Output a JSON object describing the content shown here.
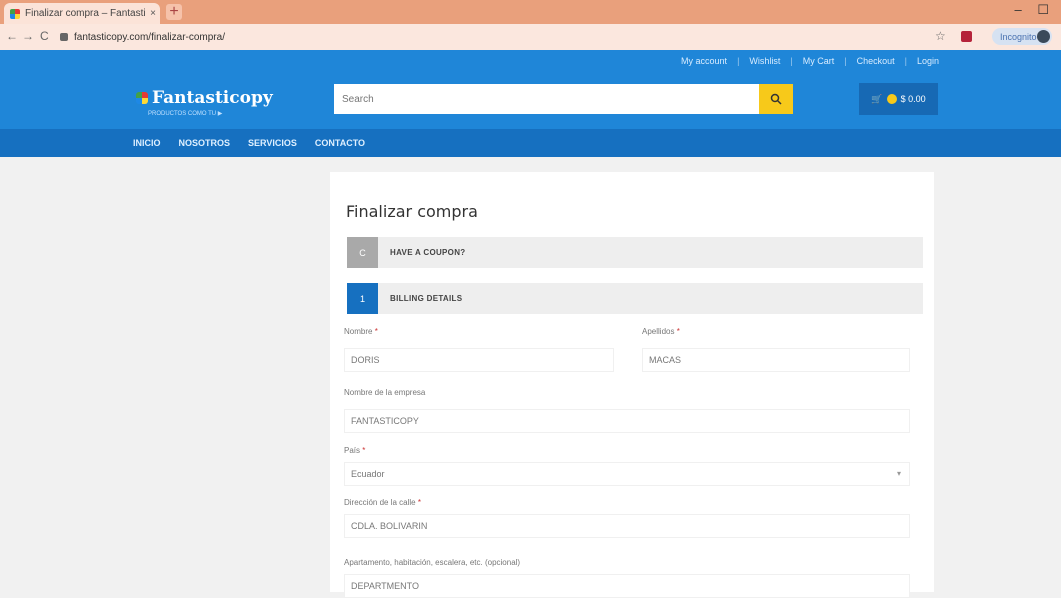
{
  "browser": {
    "tab_title": "Finalizar compra – Fantasticopy",
    "tab_close": "×",
    "new_tab": "+",
    "window_controls": "–  ☐",
    "back": "←",
    "forward": "→",
    "reload": "C",
    "url": "fantasticopy.com/finalizar-compra/",
    "profile_label": "Incognito",
    "star": "☆"
  },
  "header": {
    "top_links": [
      "My account",
      "Wishlist",
      "My Cart",
      "Checkout",
      "Login"
    ],
    "logo_text": "Fantasticopy",
    "tagline": "PRODUCTOS COMO TU ▶",
    "search_placeholder": "Search",
    "cart_label": "$ 0.00",
    "cart_icon": "cart-icon"
  },
  "nav": {
    "items": [
      "INICIO",
      "NOSOTROS",
      "SERVICIOS",
      "CONTACTO"
    ]
  },
  "checkout": {
    "title": "Finalizar compra",
    "coupon": {
      "num": "C",
      "label": "HAVE A COUPON?"
    },
    "billing": {
      "num": "1",
      "label": "BILLING DETAILS"
    },
    "fields": {
      "nombre_label": "Nombre",
      "nombre_value": "DORIS",
      "apellidos_label": "Apellidos",
      "apellidos_value": "MACAS",
      "empresa_label": "Nombre de la empresa",
      "empresa_value": "FANTASTICOPY",
      "pais_label": "País",
      "pais_value": "Ecuador",
      "direccion_label": "Dirección de la calle",
      "direccion_value": "CDLA. BOLIVARIN",
      "apartamento_label": "Apartamento, habitación, escalera, etc. (opcional)",
      "apartamento_value": "DEPARTMENTO"
    },
    "required_mark": "*"
  },
  "colors": {
    "primary": "#1f86d8",
    "nav": "#1670c0",
    "accent": "#f7c91a"
  }
}
